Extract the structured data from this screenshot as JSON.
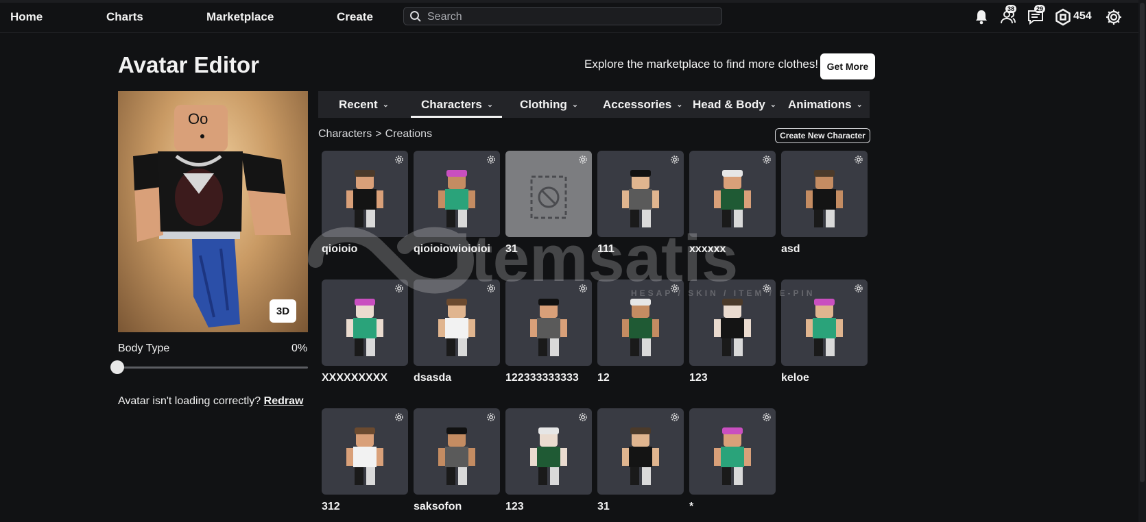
{
  "nav": {
    "home": "Home",
    "charts": "Charts",
    "marketplace": "Marketplace",
    "create": "Create",
    "search_placeholder": "Search",
    "friends_badge": "38",
    "messages_badge": "29",
    "robux": "454"
  },
  "header": {
    "title": "Avatar Editor",
    "explore_text": "Explore the marketplace to find more clothes!",
    "get_more": "Get More"
  },
  "preview": {
    "view_toggle": "3D",
    "body_type_label": "Body Type",
    "body_type_value": "0%",
    "body_type_fraction": 0,
    "loading_text": "Avatar isn't loading correctly?",
    "redraw": "Redraw"
  },
  "tabs": [
    {
      "label": "Recent"
    },
    {
      "label": "Characters"
    },
    {
      "label": "Clothing"
    },
    {
      "label": "Accessories"
    },
    {
      "label": "Head & Body"
    },
    {
      "label": "Animations"
    }
  ],
  "active_tab": "Characters",
  "breadcrumb": {
    "root": "Characters",
    "separator": ">",
    "current": "Creations"
  },
  "create_new": "Create New Character",
  "characters": [
    {
      "name": "qioioio"
    },
    {
      "name": "qioioiowioioioi"
    },
    {
      "name": "31"
    },
    {
      "name": "111"
    },
    {
      "name": "xxxxxx"
    },
    {
      "name": "asd"
    },
    {
      "name": "XXXXXXXXX"
    },
    {
      "name": "dsasda"
    },
    {
      "name": "122333333333"
    },
    {
      "name": "12"
    },
    {
      "name": "123"
    },
    {
      "name": "keloe"
    },
    {
      "name": "312"
    },
    {
      "name": "saksofon"
    },
    {
      "name": "123"
    },
    {
      "name": "31"
    },
    {
      "name": "*"
    }
  ],
  "watermark": "itemsatis",
  "watermark_sub": "HESAP / SKIN / ITEM / E-PIN"
}
